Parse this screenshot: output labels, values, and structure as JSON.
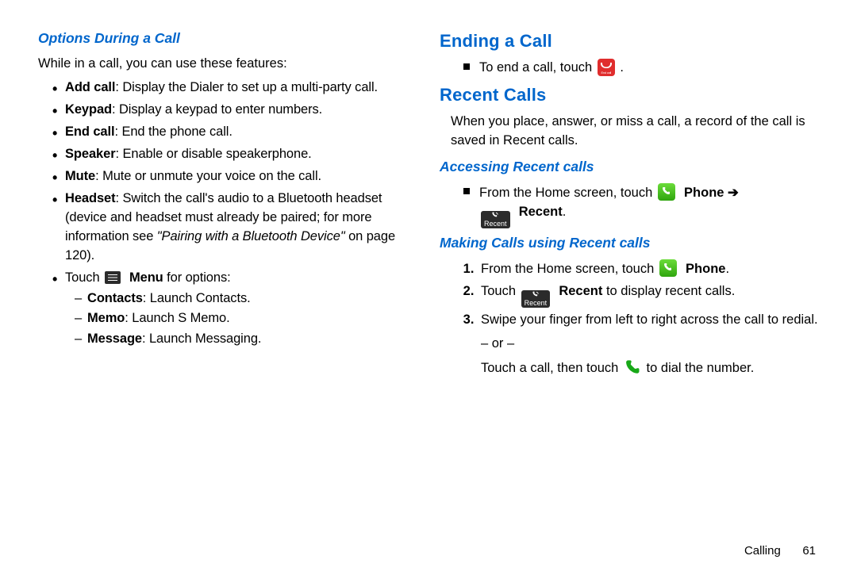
{
  "left": {
    "heading": "Options During a Call",
    "intro": "While in a call, you can use these features:",
    "features": [
      {
        "term": "Add call",
        "desc": ": Display the Dialer to set up a multi-party call."
      },
      {
        "term": "Keypad",
        "desc": ": Display a keypad to enter numbers."
      },
      {
        "term": "End call",
        "desc": ": End the phone call."
      },
      {
        "term": "Speaker",
        "desc": ": Enable or disable speakerphone."
      },
      {
        "term": "Mute",
        "desc": ": Mute or unmute your voice on the call."
      },
      {
        "term": "Headset",
        "desc": ": Switch the call's audio to a Bluetooth headset (device and headset must already be paired; for more information see "
      }
    ],
    "headset_ref_italic": "\"Pairing with a Bluetooth Device\"",
    "headset_ref_tail": " on page 120).",
    "touch_menu_prefix": "Touch ",
    "touch_menu_bold": "Menu",
    "touch_menu_suffix": " for options:",
    "submenu": [
      {
        "term": "Contacts",
        "desc": ": Launch Contacts."
      },
      {
        "term": "Memo",
        "desc": ": Launch S Memo."
      },
      {
        "term": "Message",
        "desc": ": Launch Messaging."
      }
    ]
  },
  "right": {
    "ending_heading": "Ending a Call",
    "ending_text_prefix": "To end a call, touch ",
    "ending_text_suffix": ".",
    "recent_heading": "Recent Calls",
    "recent_intro": "When you place, answer, or miss a call, a record of the call is saved in Recent calls.",
    "access_heading": "Accessing Recent calls",
    "access_text_prefix": "From the Home screen, touch ",
    "access_phone_bold": "Phone",
    "access_arrow": " ➔",
    "access_recent_bold": "Recent",
    "access_suffix": ".",
    "making_heading": "Making Calls using Recent calls",
    "steps": {
      "s1_prefix": "From the Home screen, touch ",
      "s1_phone": "Phone",
      "s1_suffix": ".",
      "s2_prefix": "Touch ",
      "s2_recent": "Recent",
      "s2_suffix": " to display recent calls.",
      "s3": "Swipe your finger from left to right across the call to redial.",
      "s3_or": "– or –",
      "s3_tail_prefix": "Touch a call, then touch ",
      "s3_tail_suffix": " to dial the number."
    }
  },
  "footer": {
    "section": "Calling",
    "page": "61"
  },
  "icons": {
    "end_call": "end-call-icon",
    "menu": "menu-icon",
    "phone_green": "phone-app-icon",
    "recent_tab": "recent-tab-icon",
    "call_green": "call-handset-icon"
  }
}
